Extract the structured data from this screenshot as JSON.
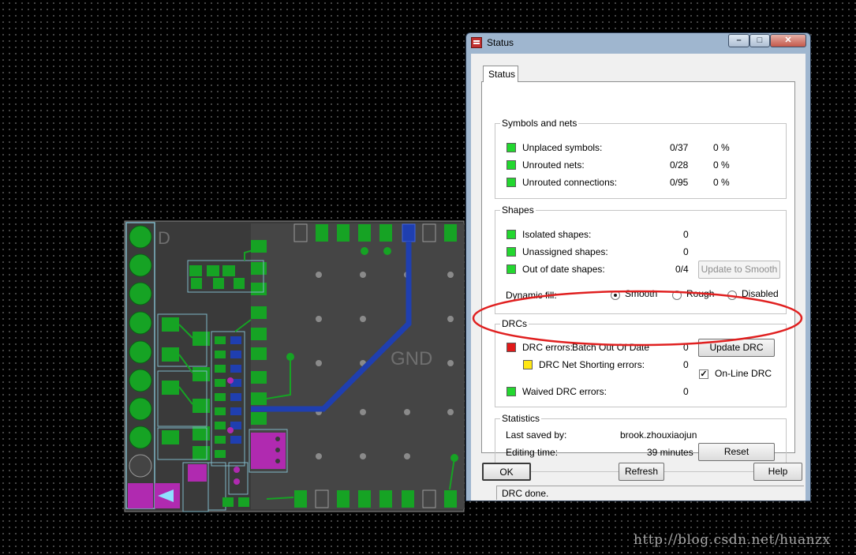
{
  "canvas": {
    "gnd_label": "GND",
    "d_label": "D",
    "watermark": "http://blog.csdn.net/huanzx"
  },
  "window": {
    "title": "Status",
    "tab_label": "Status",
    "title_icon": "app-icon",
    "minimize_icon": "minimize-icon",
    "maximize_icon": "maximize-icon",
    "close_icon": "close-icon"
  },
  "symbols_nets": {
    "title": "Symbols and nets",
    "rows": [
      {
        "label": "Unplaced symbols:",
        "count": "0/37",
        "percent": "0 %"
      },
      {
        "label": "Unrouted nets:",
        "count": "0/28",
        "percent": "0 %"
      },
      {
        "label": "Unrouted connections:",
        "count": "0/95",
        "percent": "0 %"
      }
    ]
  },
  "shapes": {
    "title": "Shapes",
    "rows": [
      {
        "label": "Isolated shapes:",
        "count": "0"
      },
      {
        "label": "Unassigned shapes:",
        "count": "0"
      },
      {
        "label": "Out of date shapes:",
        "count": "0/4"
      }
    ],
    "update_button": "Update to Smooth",
    "dynamic_fill_label": "Dynamic fill:",
    "fill_options": [
      "Smooth",
      "Rough",
      "Disabled"
    ],
    "fill_selected": "Smooth"
  },
  "drcs": {
    "title": "DRCs",
    "drc_errors_label": "DRC errors:",
    "drc_errors_status": "Batch Out Of Date",
    "drc_errors_count": "0",
    "update_button": "Update DRC",
    "net_shorting_label": "DRC Net Shorting errors:",
    "net_shorting_count": "0",
    "online_label": "On-Line DRC",
    "online_checked": true,
    "waived_label": "Waived DRC errors:",
    "waived_count": "0"
  },
  "statistics": {
    "title": "Statistics",
    "last_saved_label": "Last saved by:",
    "last_saved_value": "brook.zhouxiaojun",
    "editing_time_label": "Editing time:",
    "editing_time_value": "39 minutes",
    "reset_button": "Reset"
  },
  "buttons": {
    "ok": "OK",
    "refresh": "Refresh",
    "help": "Help"
  },
  "status_bar": "DRC done.",
  "colors": {
    "indicator_green": "#23d72f",
    "indicator_red": "#e01a1a",
    "indicator_yellow": "#ffe714",
    "annotation_red": "#e02020",
    "pcb_green": "#0f9a1e",
    "pcb_magenta": "#b02ab0",
    "pcb_blue": "#1f3fb0"
  }
}
